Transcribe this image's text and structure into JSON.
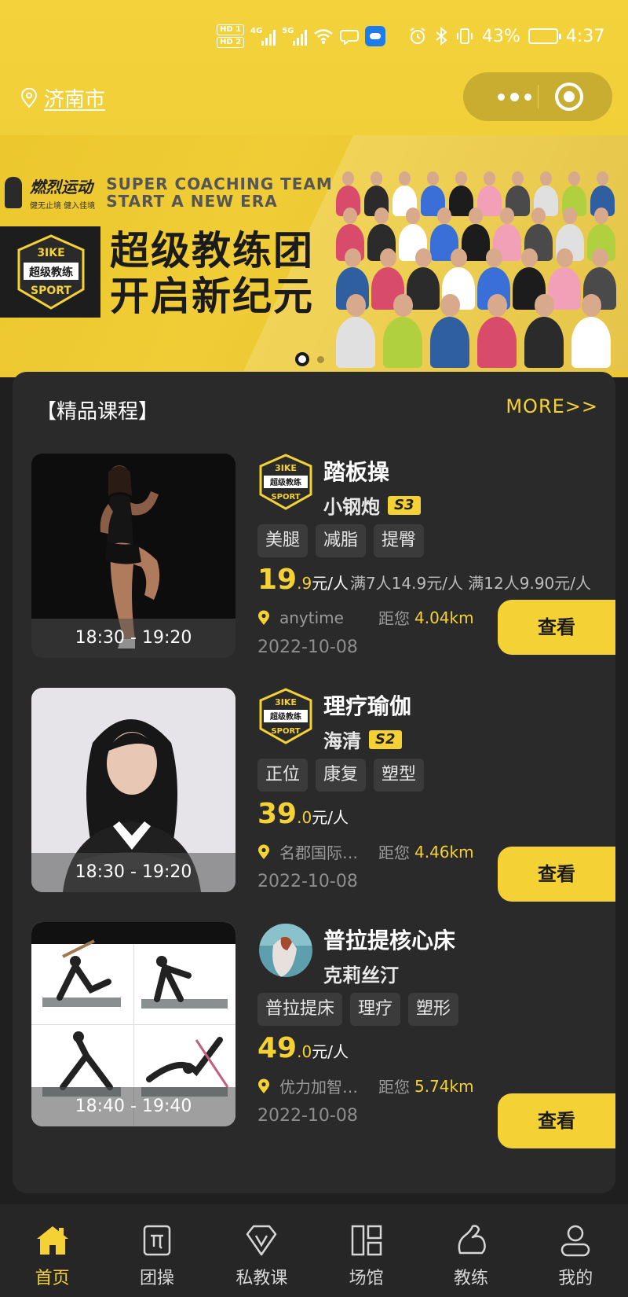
{
  "status_bar": {
    "sim1": "HD 1",
    "sim2": "HD 2",
    "net1": "4G",
    "net2": "5G",
    "battery_text": "43%",
    "battery_level": 0.43,
    "time": "4:37"
  },
  "header": {
    "city": "济南市",
    "menu_icon": "more-dots-icon",
    "close_icon": "target-circle-icon"
  },
  "banner": {
    "brand_cn": "燃烈运动",
    "brand_slogan": "健无止境 健入佳境",
    "brand_en_line1": "SUPER COACHING TEAM",
    "brand_en_line2": "START A NEW ERA",
    "title_line1": "超级教练团",
    "title_line2": "开启新纪元",
    "logo_top": "3IKE",
    "logo_mid": "超级教练",
    "logo_bottom": "SPORT",
    "current_slide": 1,
    "total_slides": 2
  },
  "section": {
    "title": "【精品课程】",
    "more": "MORE>>"
  },
  "courses": [
    {
      "time": "18:30 - 19:20",
      "name": "踏板操",
      "coach": "小钢炮",
      "level": "S3",
      "tags": [
        "美腿",
        "减脂",
        "提臀"
      ],
      "price_int": "19",
      "price_dec": ".9",
      "unit": "元/人",
      "group_price": "满7人14.9元/人  满12人9.90元/人",
      "venue": "anytime",
      "distance_label": "距您",
      "distance": "4.04km",
      "date": "2022-10-08",
      "button": "查看"
    },
    {
      "time": "18:30 - 19:20",
      "name": "理疗瑜伽",
      "coach": "海清",
      "level": "S2",
      "tags": [
        "正位",
        "康复",
        "塑型"
      ],
      "price_int": "39",
      "price_dec": ".0",
      "unit": "元/人",
      "group_price": "",
      "venue": "名郡国际…",
      "distance_label": "距您",
      "distance": "4.46km",
      "date": "2022-10-08",
      "button": "查看"
    },
    {
      "time": "18:40 - 19:40",
      "name": "普拉提核心床",
      "coach": "克莉丝汀",
      "level": "",
      "tags": [
        "普拉提床",
        "理疗",
        "塑形"
      ],
      "price_int": "49",
      "price_dec": ".0",
      "unit": "元/人",
      "group_price": "",
      "venue": "优力加智…",
      "distance_label": "距您",
      "distance": "5.74km",
      "date": "2022-10-08",
      "button": "查看"
    }
  ],
  "tabbar": [
    {
      "label": "首页",
      "icon": "home-icon",
      "active": true
    },
    {
      "label": "团操",
      "icon": "group-class-icon",
      "active": false
    },
    {
      "label": "私教课",
      "icon": "private-class-icon",
      "active": false
    },
    {
      "label": "场馆",
      "icon": "venue-icon",
      "active": false
    },
    {
      "label": "教练",
      "icon": "coach-icon",
      "active": false
    },
    {
      "label": "我的",
      "icon": "profile-icon",
      "active": false
    }
  ],
  "colors": {
    "accent": "#f4d235",
    "background": "#1f1f1f",
    "card": "#2a2a2a",
    "tag_bg": "#3b3b3b"
  }
}
